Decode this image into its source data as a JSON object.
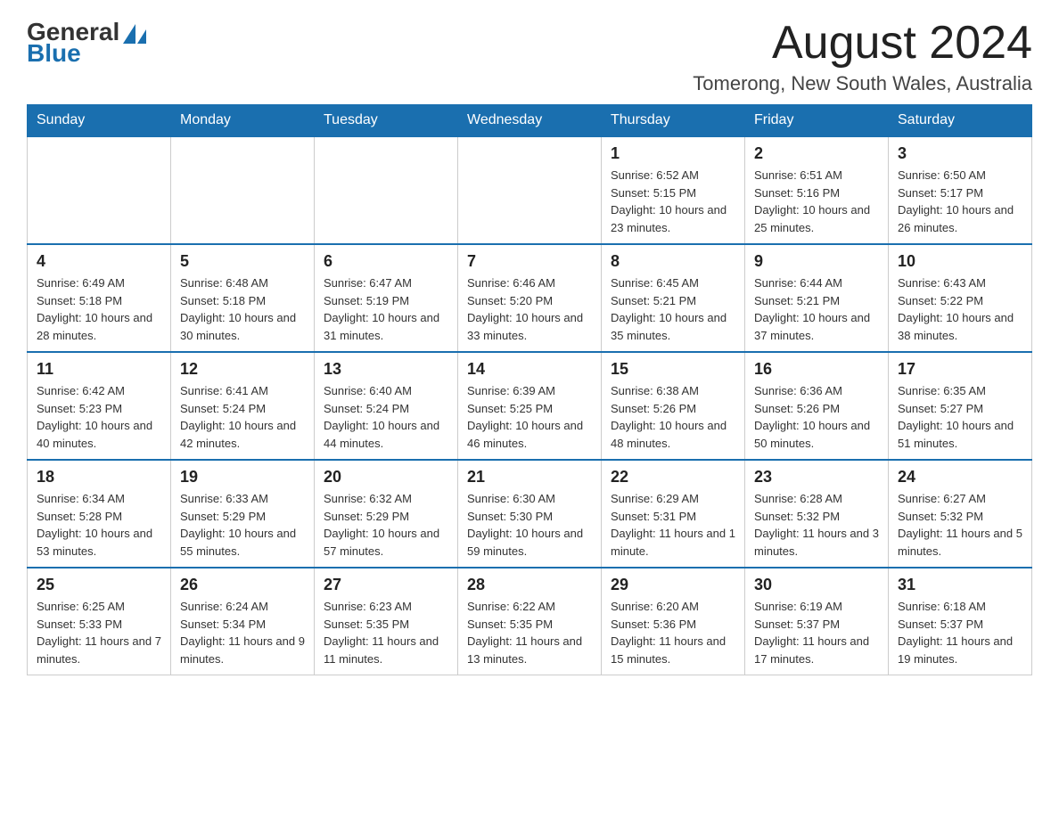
{
  "header": {
    "logo_general": "General",
    "logo_blue": "Blue",
    "month_title": "August 2024",
    "location": "Tomerong, New South Wales, Australia"
  },
  "weekdays": [
    "Sunday",
    "Monday",
    "Tuesday",
    "Wednesday",
    "Thursday",
    "Friday",
    "Saturday"
  ],
  "weeks": [
    [
      {
        "day": "",
        "info": ""
      },
      {
        "day": "",
        "info": ""
      },
      {
        "day": "",
        "info": ""
      },
      {
        "day": "",
        "info": ""
      },
      {
        "day": "1",
        "info": "Sunrise: 6:52 AM\nSunset: 5:15 PM\nDaylight: 10 hours and 23 minutes."
      },
      {
        "day": "2",
        "info": "Sunrise: 6:51 AM\nSunset: 5:16 PM\nDaylight: 10 hours and 25 minutes."
      },
      {
        "day": "3",
        "info": "Sunrise: 6:50 AM\nSunset: 5:17 PM\nDaylight: 10 hours and 26 minutes."
      }
    ],
    [
      {
        "day": "4",
        "info": "Sunrise: 6:49 AM\nSunset: 5:18 PM\nDaylight: 10 hours and 28 minutes."
      },
      {
        "day": "5",
        "info": "Sunrise: 6:48 AM\nSunset: 5:18 PM\nDaylight: 10 hours and 30 minutes."
      },
      {
        "day": "6",
        "info": "Sunrise: 6:47 AM\nSunset: 5:19 PM\nDaylight: 10 hours and 31 minutes."
      },
      {
        "day": "7",
        "info": "Sunrise: 6:46 AM\nSunset: 5:20 PM\nDaylight: 10 hours and 33 minutes."
      },
      {
        "day": "8",
        "info": "Sunrise: 6:45 AM\nSunset: 5:21 PM\nDaylight: 10 hours and 35 minutes."
      },
      {
        "day": "9",
        "info": "Sunrise: 6:44 AM\nSunset: 5:21 PM\nDaylight: 10 hours and 37 minutes."
      },
      {
        "day": "10",
        "info": "Sunrise: 6:43 AM\nSunset: 5:22 PM\nDaylight: 10 hours and 38 minutes."
      }
    ],
    [
      {
        "day": "11",
        "info": "Sunrise: 6:42 AM\nSunset: 5:23 PM\nDaylight: 10 hours and 40 minutes."
      },
      {
        "day": "12",
        "info": "Sunrise: 6:41 AM\nSunset: 5:24 PM\nDaylight: 10 hours and 42 minutes."
      },
      {
        "day": "13",
        "info": "Sunrise: 6:40 AM\nSunset: 5:24 PM\nDaylight: 10 hours and 44 minutes."
      },
      {
        "day": "14",
        "info": "Sunrise: 6:39 AM\nSunset: 5:25 PM\nDaylight: 10 hours and 46 minutes."
      },
      {
        "day": "15",
        "info": "Sunrise: 6:38 AM\nSunset: 5:26 PM\nDaylight: 10 hours and 48 minutes."
      },
      {
        "day": "16",
        "info": "Sunrise: 6:36 AM\nSunset: 5:26 PM\nDaylight: 10 hours and 50 minutes."
      },
      {
        "day": "17",
        "info": "Sunrise: 6:35 AM\nSunset: 5:27 PM\nDaylight: 10 hours and 51 minutes."
      }
    ],
    [
      {
        "day": "18",
        "info": "Sunrise: 6:34 AM\nSunset: 5:28 PM\nDaylight: 10 hours and 53 minutes."
      },
      {
        "day": "19",
        "info": "Sunrise: 6:33 AM\nSunset: 5:29 PM\nDaylight: 10 hours and 55 minutes."
      },
      {
        "day": "20",
        "info": "Sunrise: 6:32 AM\nSunset: 5:29 PM\nDaylight: 10 hours and 57 minutes."
      },
      {
        "day": "21",
        "info": "Sunrise: 6:30 AM\nSunset: 5:30 PM\nDaylight: 10 hours and 59 minutes."
      },
      {
        "day": "22",
        "info": "Sunrise: 6:29 AM\nSunset: 5:31 PM\nDaylight: 11 hours and 1 minute."
      },
      {
        "day": "23",
        "info": "Sunrise: 6:28 AM\nSunset: 5:32 PM\nDaylight: 11 hours and 3 minutes."
      },
      {
        "day": "24",
        "info": "Sunrise: 6:27 AM\nSunset: 5:32 PM\nDaylight: 11 hours and 5 minutes."
      }
    ],
    [
      {
        "day": "25",
        "info": "Sunrise: 6:25 AM\nSunset: 5:33 PM\nDaylight: 11 hours and 7 minutes."
      },
      {
        "day": "26",
        "info": "Sunrise: 6:24 AM\nSunset: 5:34 PM\nDaylight: 11 hours and 9 minutes."
      },
      {
        "day": "27",
        "info": "Sunrise: 6:23 AM\nSunset: 5:35 PM\nDaylight: 11 hours and 11 minutes."
      },
      {
        "day": "28",
        "info": "Sunrise: 6:22 AM\nSunset: 5:35 PM\nDaylight: 11 hours and 13 minutes."
      },
      {
        "day": "29",
        "info": "Sunrise: 6:20 AM\nSunset: 5:36 PM\nDaylight: 11 hours and 15 minutes."
      },
      {
        "day": "30",
        "info": "Sunrise: 6:19 AM\nSunset: 5:37 PM\nDaylight: 11 hours and 17 minutes."
      },
      {
        "day": "31",
        "info": "Sunrise: 6:18 AM\nSunset: 5:37 PM\nDaylight: 11 hours and 19 minutes."
      }
    ]
  ]
}
